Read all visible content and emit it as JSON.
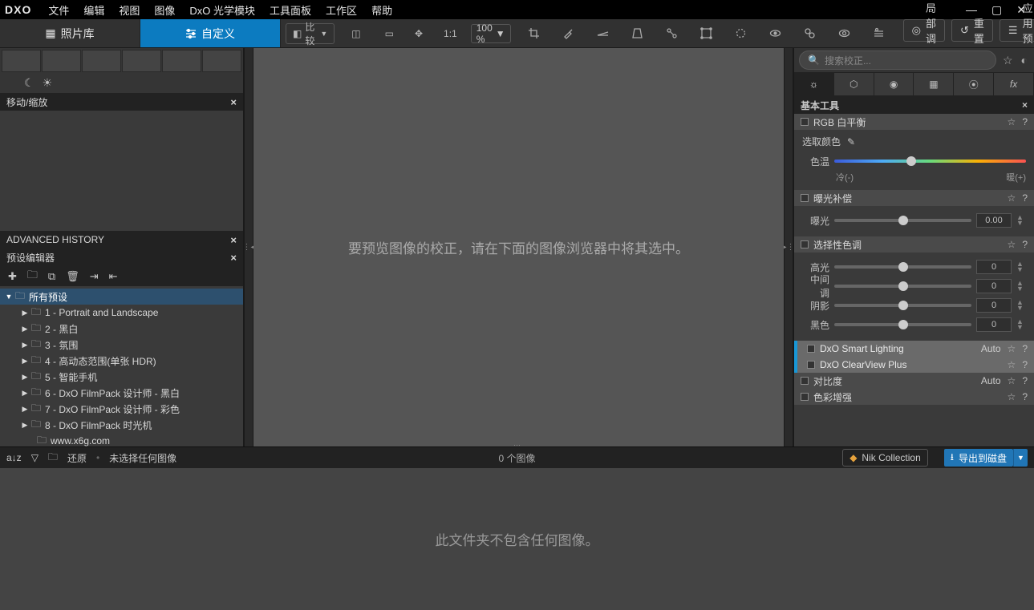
{
  "menu": [
    "文件",
    "编辑",
    "视图",
    "图像",
    "DxO 光学模块",
    "工具面板",
    "工作区",
    "帮助"
  ],
  "logo": "DXO",
  "modes": {
    "library": "照片库",
    "custom": "自定义"
  },
  "toolbar": {
    "compare": "比较",
    "ratio": "1:1",
    "zoom": "100 %",
    "local": "局部调整",
    "reset": "重置",
    "applyPreset": "应用预设"
  },
  "left": {
    "moveZoom": "移动/缩放",
    "history": "ADVANCED HISTORY",
    "presetEditor": "预设编辑器",
    "presetsRoot": "所有预设",
    "presets": [
      "1 - Portrait and Landscape",
      "2 - 黑白",
      "3 - 氛围",
      "4 - 高动态范围(单张 HDR)",
      "5 - 智能手机",
      "6 - DxO FilmPack 设计师 - 黑白",
      "7 - DxO FilmPack 设计师 - 彩色",
      "8 - DxO FilmPack 时光机"
    ],
    "leaf": "www.x6g.com"
  },
  "center": {
    "msg": "要预览图像的校正，请在下面的图像浏览器中将其选中。"
  },
  "right": {
    "searchPH": "搜索校正...",
    "basicTools": "基本工具",
    "rgbWB": "RGB 白平衡",
    "pickColor": "选取颜色",
    "temp": "色温",
    "tempCold": "冷(-)",
    "tempWarm": "暖(+)",
    "expoComp": "曝光补偿",
    "exposure": "曝光",
    "exposureVal": "0.00",
    "selTone": "选择性色调",
    "highlights": "高光",
    "midtones": "中间调",
    "shadows": "阴影",
    "blacks": "黑色",
    "zero": "0",
    "smartLight": "DxO Smart Lighting",
    "clearview": "DxO ClearView Plus",
    "contrast": "对比度",
    "colorEnhance": "色彩增强",
    "auto": "Auto"
  },
  "status": {
    "restore": "还原",
    "noSel": "未选择任何图像",
    "count": "0 个图像",
    "nik": "Nik Collection",
    "export": "导出到磁盘"
  },
  "browser": {
    "empty": "此文件夹不包含任何图像。"
  }
}
